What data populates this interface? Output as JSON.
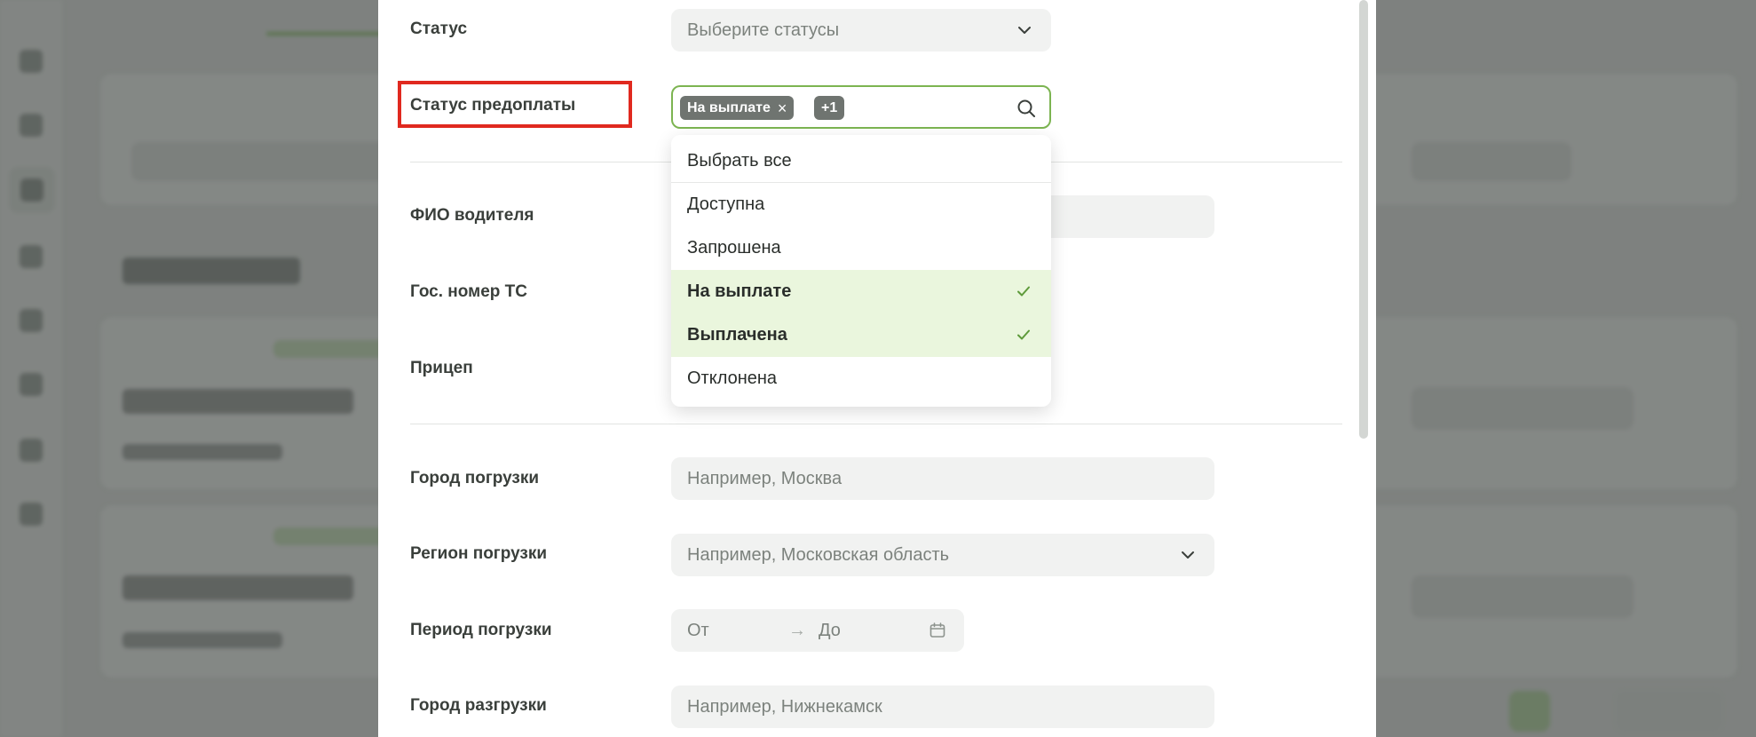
{
  "form": {
    "status": {
      "label": "Статус",
      "placeholder": "Выберите статусы"
    },
    "prepay_status": {
      "label": "Статус предоплаты",
      "tags": [
        {
          "text": "На выплате",
          "removable": true
        },
        {
          "text": "+1",
          "removable": false
        }
      ]
    },
    "driver_name": {
      "label": "ФИО водителя"
    },
    "vehicle_number": {
      "label": "Гос. номер ТС"
    },
    "trailer": {
      "label": "Прицеп"
    },
    "load_city": {
      "label": "Город погрузки",
      "placeholder": "Например, Москва"
    },
    "load_region": {
      "label": "Регион погрузки",
      "placeholder": "Например, Московская область"
    },
    "load_period": {
      "label": "Период погрузки",
      "from": "От",
      "arrow": "→",
      "to": "До"
    },
    "unload_city": {
      "label": "Город разгрузки",
      "placeholder": "Например, Нижнекамск"
    }
  },
  "dropdown": {
    "options": [
      {
        "label": "Выбрать все",
        "selected": false
      },
      {
        "label": "Доступна",
        "selected": false
      },
      {
        "label": "Запрошена",
        "selected": false
      },
      {
        "label": "На выплате",
        "selected": true
      },
      {
        "label": "Выплачена",
        "selected": true
      },
      {
        "label": "Отклонена",
        "selected": false
      }
    ]
  },
  "colors": {
    "accent_border": "#7cb451",
    "selected_bg": "#eaf6dd",
    "check": "#5e9a3a",
    "highlight": "#e0291f",
    "tag_bg": "#6f7470"
  },
  "icons": {
    "select_chevron": "chevron-down-icon",
    "search": "search-icon",
    "check": "check-icon",
    "calendar": "calendar-icon",
    "tag_remove": "close-icon"
  }
}
